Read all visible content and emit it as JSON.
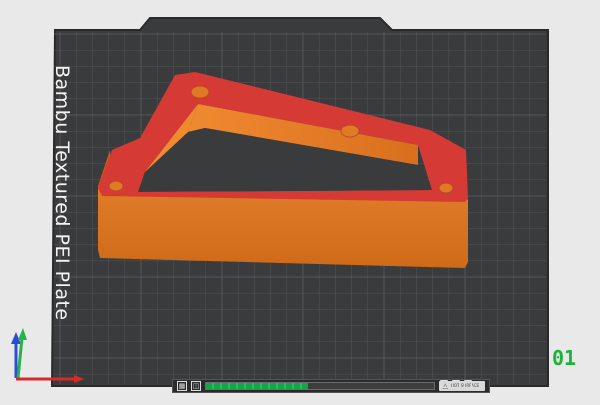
{
  "plate": {
    "label": "Bambu Textured PEI Plate",
    "number": "01",
    "bed_color": "#3a3b3d",
    "grid_color": "#555659",
    "model_top_color": "#d63a34",
    "model_side_color": "#e2781c"
  },
  "bottom_bar": {
    "fill_fraction": 0.45,
    "warning_text": "HOT SURFACE",
    "warning_icon": "warning-triangle-icon",
    "left_icons": [
      "grid-icon",
      "layout-icon"
    ],
    "right_icons": [
      "nozzle-icon",
      "screen-icon",
      "nozzle-icon"
    ]
  },
  "axes": {
    "x_color": "#d72b2b",
    "y_color": "#27b34a",
    "z_color": "#2a4ed6"
  }
}
